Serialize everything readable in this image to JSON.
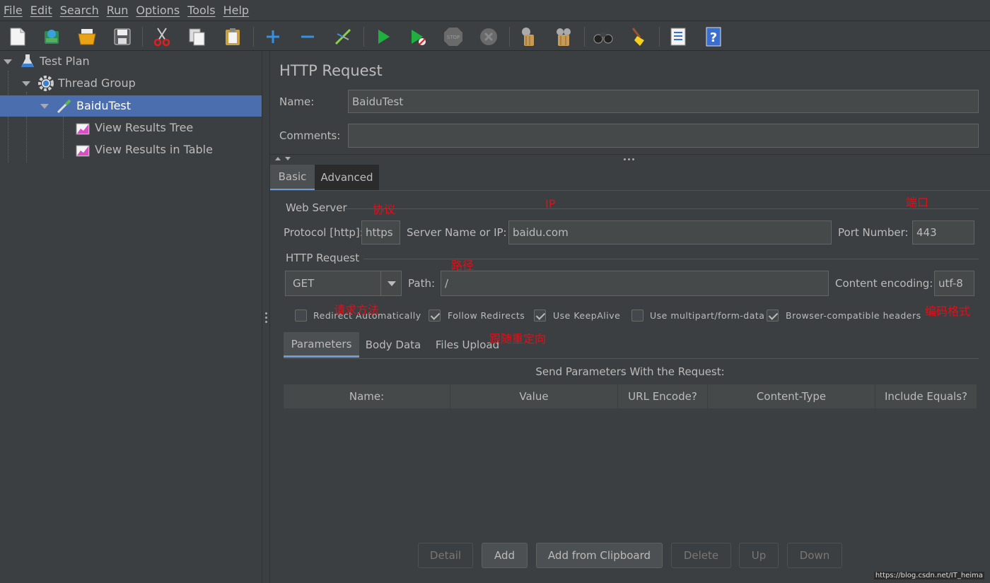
{
  "menu": [
    "File",
    "Edit",
    "Search",
    "Run",
    "Options",
    "Tools",
    "Help"
  ],
  "toolbar_icons": [
    "new-icon",
    "templates-icon",
    "open-icon",
    "save-icon",
    "cut-icon",
    "copy-icon",
    "paste-icon",
    "expand-icon",
    "collapse-icon",
    "toggle-icon",
    "start-icon",
    "start-no-pause-icon",
    "stop-icon",
    "shutdown-icon",
    "clear-icon",
    "clear-all-icon",
    "search-icon",
    "reset-search-icon",
    "function-helper-icon",
    "help-icon"
  ],
  "tree": [
    {
      "label": "Test Plan",
      "icon": "test-plan-icon"
    },
    {
      "label": "Thread Group",
      "icon": "thread-group-gear-icon"
    },
    {
      "label": "BaiduTest",
      "icon": "sampler-pipette-icon"
    },
    {
      "label": "View Results Tree",
      "icon": "listener-chart-icon"
    },
    {
      "label": "View Results in Table",
      "icon": "listener-chart-icon"
    }
  ],
  "panel": {
    "title": "HTTP Request",
    "name_label": "Name:",
    "name_value": "BaiduTest",
    "comments_label": "Comments:",
    "comments_value": ""
  },
  "tabs": {
    "basic": "Basic",
    "advanced": "Advanced"
  },
  "web_server": {
    "section": "Web Server",
    "protocol_label": "Protocol [http]:",
    "protocol_value": "https",
    "server_label": "Server Name or IP:",
    "server_value": "baidu.com",
    "port_label": "Port Number:",
    "port_value": "443"
  },
  "http_request": {
    "section": "HTTP Request",
    "method": "GET",
    "path_label": "Path:",
    "path_value": "/",
    "encoding_label": "Content encoding:",
    "encoding_value": "utf-8"
  },
  "options": [
    {
      "label": "Redirect Automatically",
      "checked": false
    },
    {
      "label": "Follow Redirects",
      "checked": true
    },
    {
      "label": "Use KeepAlive",
      "checked": true
    },
    {
      "label": "Use multipart/form-data",
      "checked": false
    },
    {
      "label": "Browser-compatible headers",
      "checked": true
    }
  ],
  "subtabs": {
    "parameters": "Parameters",
    "body": "Body Data",
    "files": "Files Upload"
  },
  "params": {
    "caption": "Send Parameters With the Request:",
    "columns": [
      "Name:",
      "Value",
      "URL Encode?",
      "Content-Type",
      "Include Equals?"
    ]
  },
  "buttons": {
    "detail": "Detail",
    "add": "Add",
    "add_clipboard": "Add from Clipboard",
    "delete": "Delete",
    "up": "Up",
    "down": "Down"
  },
  "annotations": {
    "protocol": "协议",
    "ip": "IP",
    "port": "端口",
    "path": "路径",
    "method": "请求方法",
    "encoding": "编码格式",
    "redirect": "跟随重定向"
  },
  "watermark": "https://blog.csdn.net/IT_heima",
  "colors": {
    "background": "#3c3f41",
    "selection": "#4b6eaf",
    "annotation": "#e0101a",
    "field": "#45494a"
  }
}
